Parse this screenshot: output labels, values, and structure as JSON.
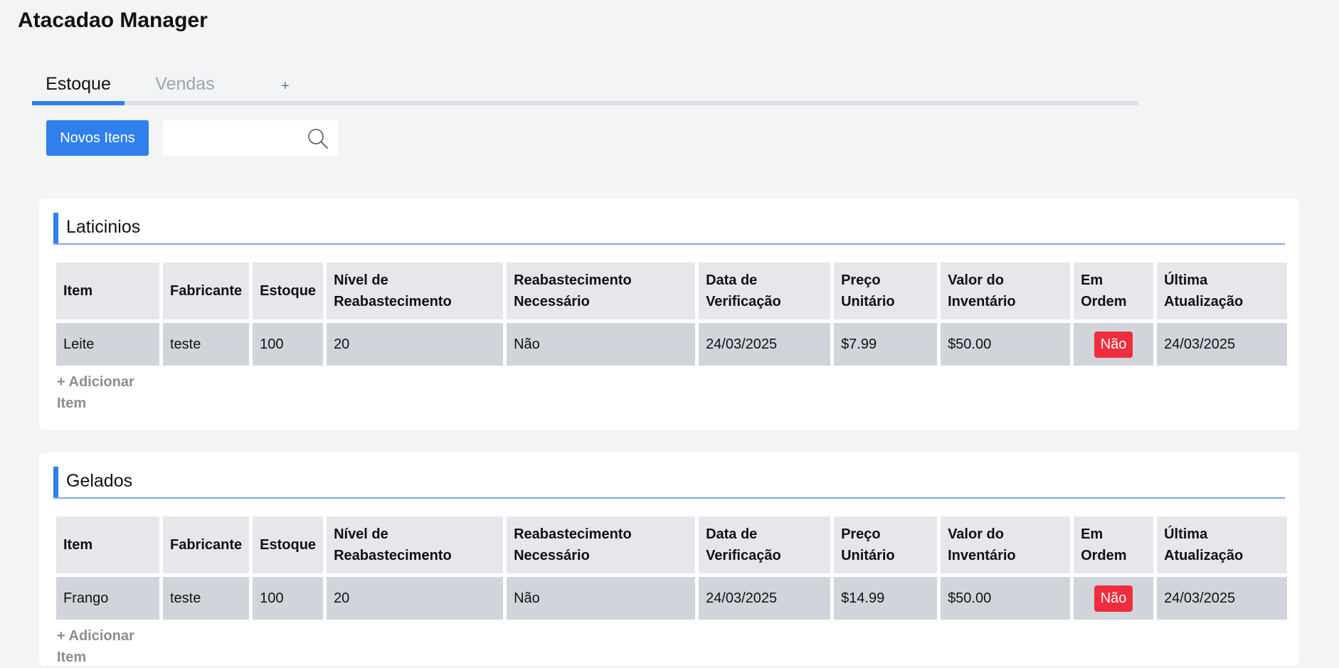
{
  "app": {
    "title": "Atacadao Manager"
  },
  "tabs": [
    {
      "label": "Estoque",
      "active": true
    },
    {
      "label": "Vendas",
      "active": false
    },
    {
      "label": "+",
      "active": false
    }
  ],
  "toolbar": {
    "new_items_label": "Novos Itens",
    "search_value": "",
    "search_icon": "search-icon"
  },
  "columns": [
    "Item",
    "Fabricante",
    "Estoque",
    "Nível de Reabastecimento",
    "Reabastecimento Necessário",
    "Data de Verificação",
    "Preço Unitário",
    "Valor do Inventário",
    "Em Ordem",
    "Última Atualização"
  ],
  "sections": [
    {
      "title": "Laticinios",
      "rows": [
        {
          "item": "Leite",
          "fabricante": "teste",
          "estoque": "100",
          "nivel": "20",
          "necessario": "Não",
          "data": "24/03/2025",
          "preco": "$7.99",
          "valor": "$50.00",
          "em_ordem": "Não",
          "atualizacao": "24/03/2025"
        }
      ],
      "add_label": "+ Adicionar Item"
    },
    {
      "title": "Gelados",
      "rows": [
        {
          "item": "Frango",
          "fabricante": "teste",
          "estoque": "100",
          "nivel": "20",
          "necessario": "Não",
          "data": "24/03/2025",
          "preco": "$14.99",
          "valor": "$50.00",
          "em_ordem": "Não",
          "atualizacao": "24/03/2025"
        }
      ],
      "add_label": "+ Adicionar Item"
    }
  ],
  "colors": {
    "accent": "#2f80ed",
    "danger": "#ef2d3c",
    "background": "#f3f4f6"
  }
}
